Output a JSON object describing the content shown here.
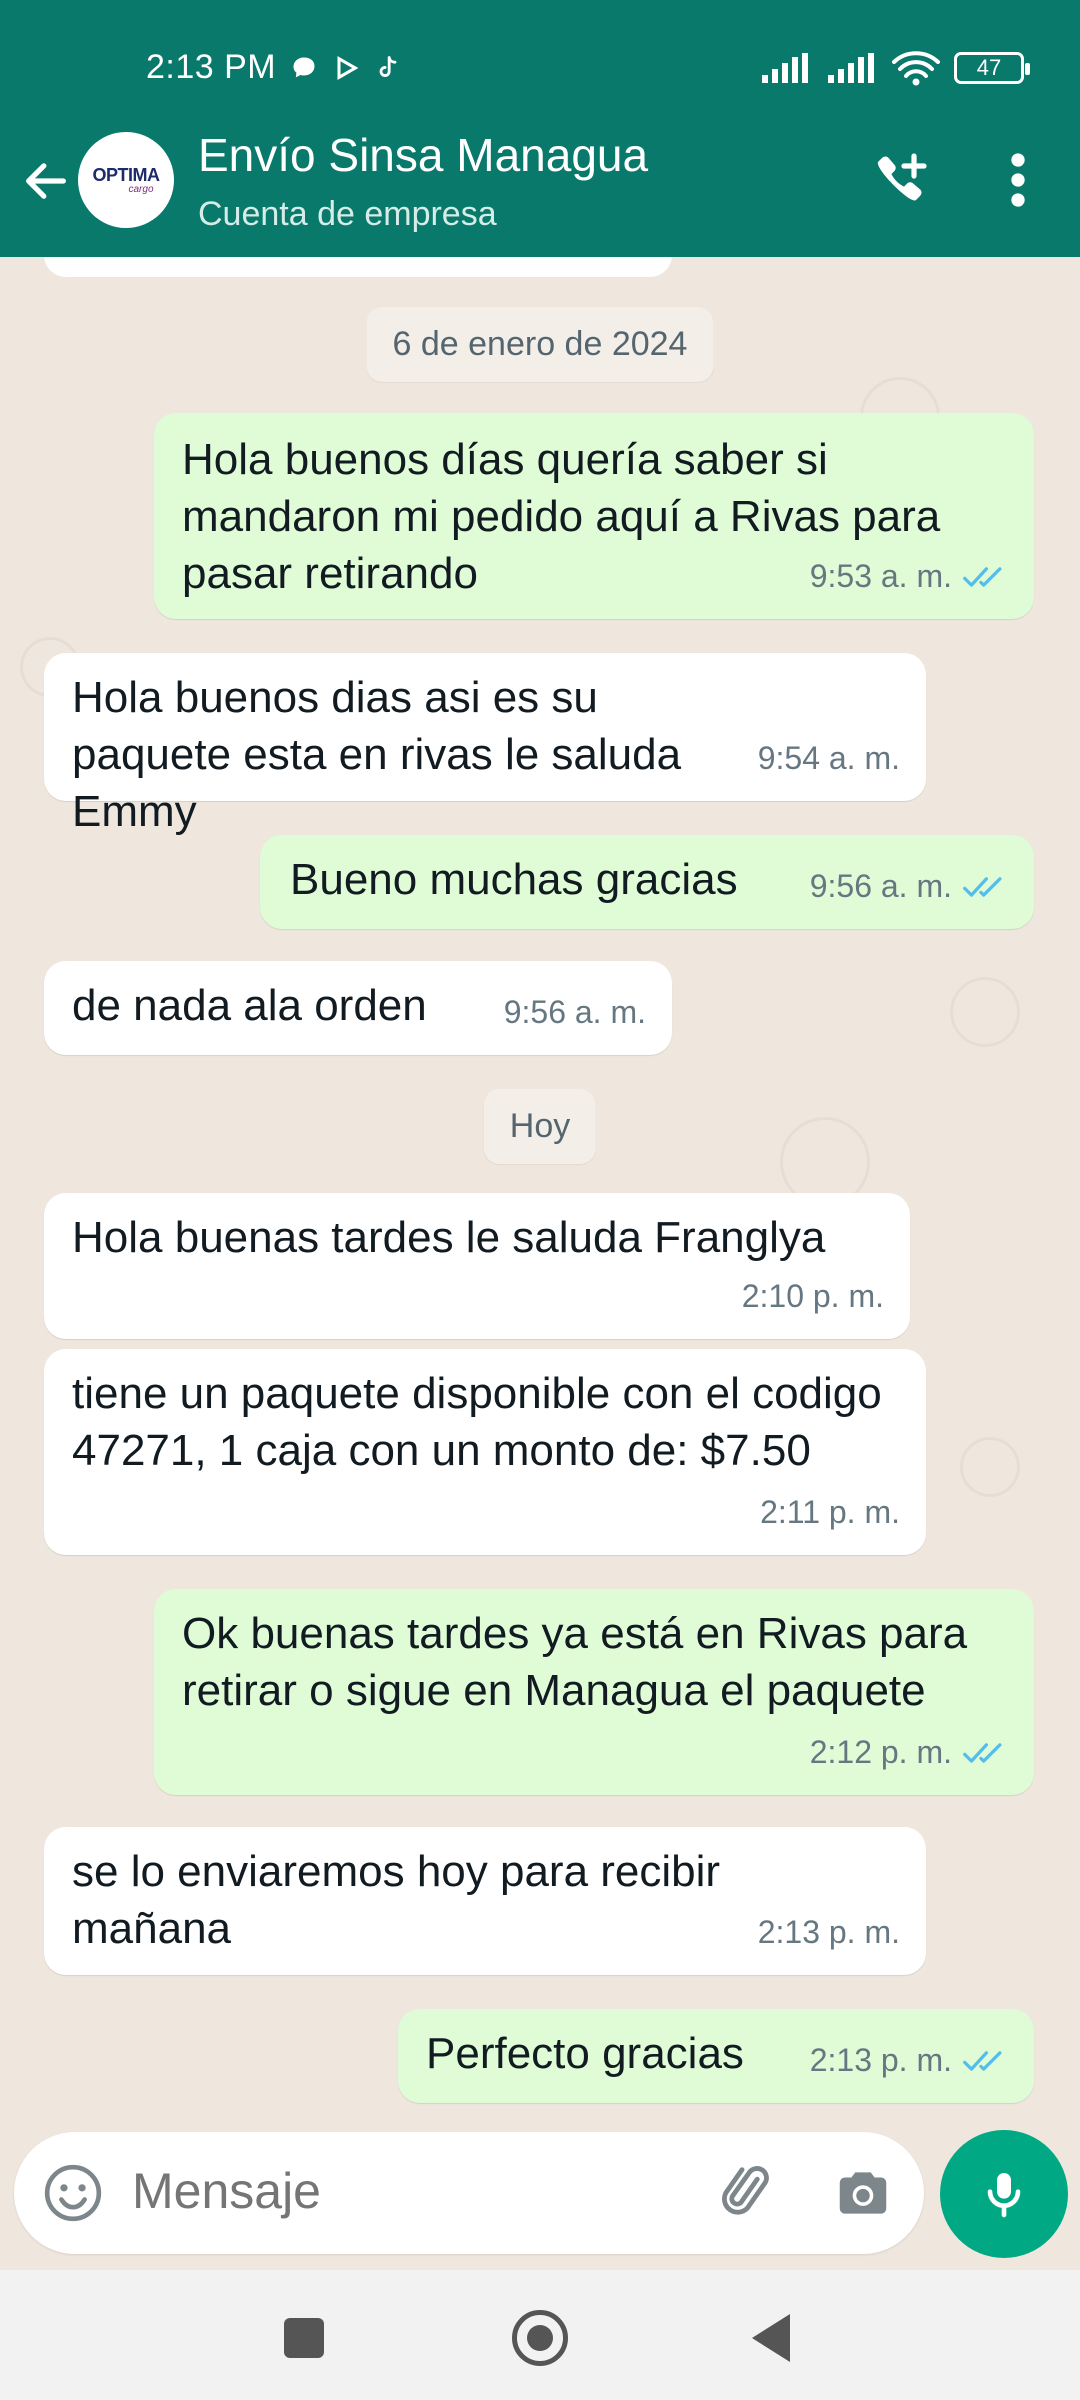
{
  "status_bar": {
    "time": "2:13 PM",
    "battery": "47"
  },
  "header": {
    "title": "Envío Sinsa Managua",
    "subtitle": "Cuenta de empresa",
    "avatar_logo": "OPTIMA",
    "avatar_logo_sub": "cargo"
  },
  "date_chips": [
    "6 de enero de 2024",
    "Hoy"
  ],
  "messages": [
    {
      "dir": "out",
      "text": "Hola buenos días quería saber si mandaron mi pedido aquí a Rivas para pasar retirando",
      "time": "9:53 a. m."
    },
    {
      "dir": "in",
      "text": "Hola buenos dias asi es su paquete esta en rivas le saluda Emmy",
      "time": "9:54 a. m."
    },
    {
      "dir": "out",
      "text": "Bueno muchas gracias",
      "time": "9:56 a. m."
    },
    {
      "dir": "in",
      "text": "de nada ala orden",
      "time": "9:56 a. m."
    },
    {
      "dir": "in",
      "text": "Hola buenas tardes le saluda Franglya",
      "time": "2:10 p. m."
    },
    {
      "dir": "in",
      "text": "tiene un paquete disponible con el codigo 47271, 1 caja con un monto de: $7.50",
      "time": "2:11 p. m."
    },
    {
      "dir": "out",
      "text": "Ok buenas tardes ya está en Rivas para retirar o sigue en Managua el paquete",
      "time": "2:12 p. m."
    },
    {
      "dir": "in",
      "text": "se lo enviaremos hoy para recibir mañana",
      "time": "2:13 p. m."
    },
    {
      "dir": "out",
      "text": "Perfecto gracias",
      "time": "2:13 p. m."
    }
  ],
  "composer": {
    "placeholder": "Mensaje"
  },
  "colors": {
    "header": "#08796b",
    "outgoing": "#e0fcd6",
    "incoming": "#ffffff",
    "accent": "#00a884",
    "tick": "#53bdeb"
  }
}
